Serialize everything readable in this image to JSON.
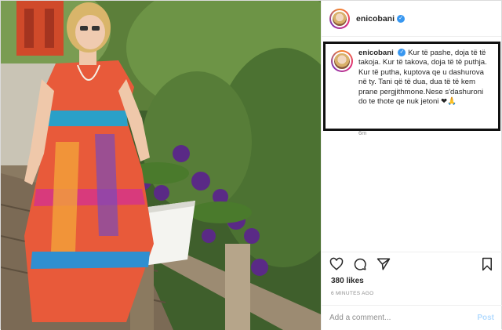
{
  "header": {
    "username": "enicobani",
    "verified_icon": "verified-badge-icon"
  },
  "caption": {
    "username": "enicobani",
    "text": "Kur të pashe, doja të të takoja. Kur të takova, doja të të puthja. Kur të putha, kuptova qe u dashurova në ty. Tani që të dua, dua të të kem prane pergjithmone.Nese s'dashuroni do te thote qe nuk jetoni ❤🙏",
    "age": "6m"
  },
  "actions": {
    "like_icon": "heart-icon",
    "comment_icon": "comment-icon",
    "share_icon": "share-icon",
    "save_icon": "bookmark-icon"
  },
  "likes": "380 likes",
  "posted": "6 MINUTES AGO",
  "comment": {
    "placeholder": "Add a comment...",
    "post_label": "Post"
  },
  "colors": {
    "verified": "#3897f0",
    "post_button": "#b3dbff",
    "muted_text": "#8e8e8e"
  }
}
